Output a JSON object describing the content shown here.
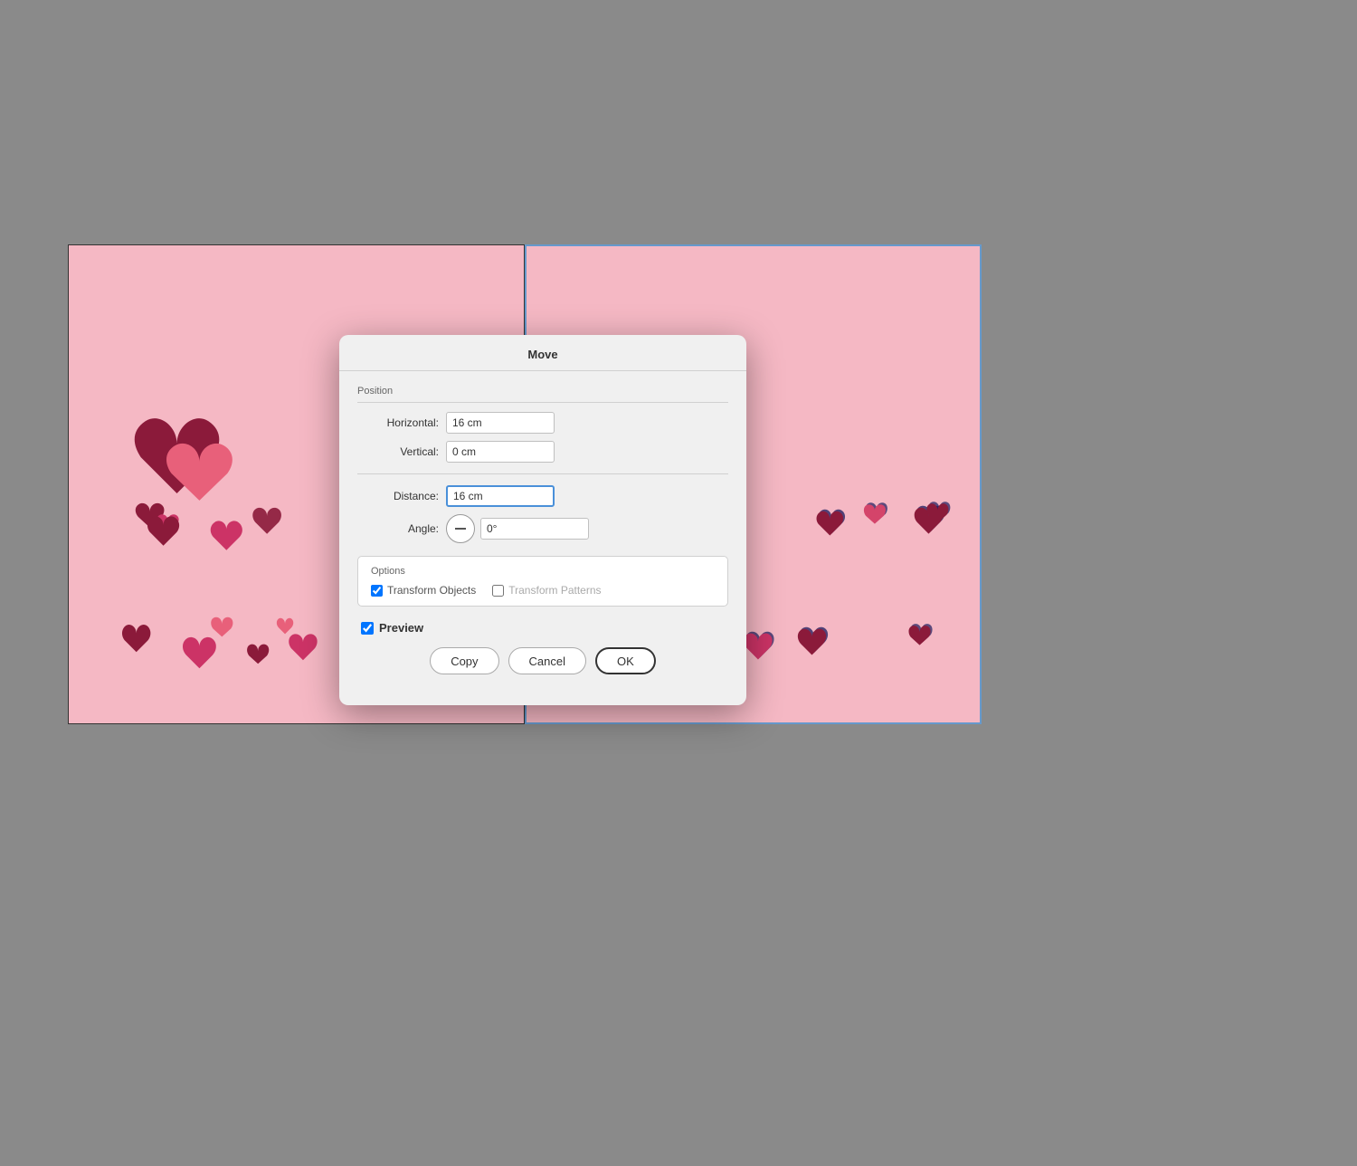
{
  "canvas": {
    "background_color": "#f5b8c4"
  },
  "dialog": {
    "title": "Move",
    "position_label": "Position",
    "horizontal_label": "Horizontal:",
    "horizontal_value": "16 cm",
    "vertical_label": "Vertical:",
    "vertical_value": "0 cm",
    "distance_label": "Distance:",
    "distance_value": "16 cm",
    "angle_label": "Angle:",
    "angle_value": "0°",
    "options_label": "Options",
    "transform_objects_label": "Transform Objects",
    "transform_patterns_label": "Transform Patterns",
    "transform_objects_checked": true,
    "transform_patterns_checked": false,
    "preview_label": "Preview",
    "preview_checked": true,
    "copy_button": "Copy",
    "cancel_button": "Cancel",
    "ok_button": "OK"
  }
}
